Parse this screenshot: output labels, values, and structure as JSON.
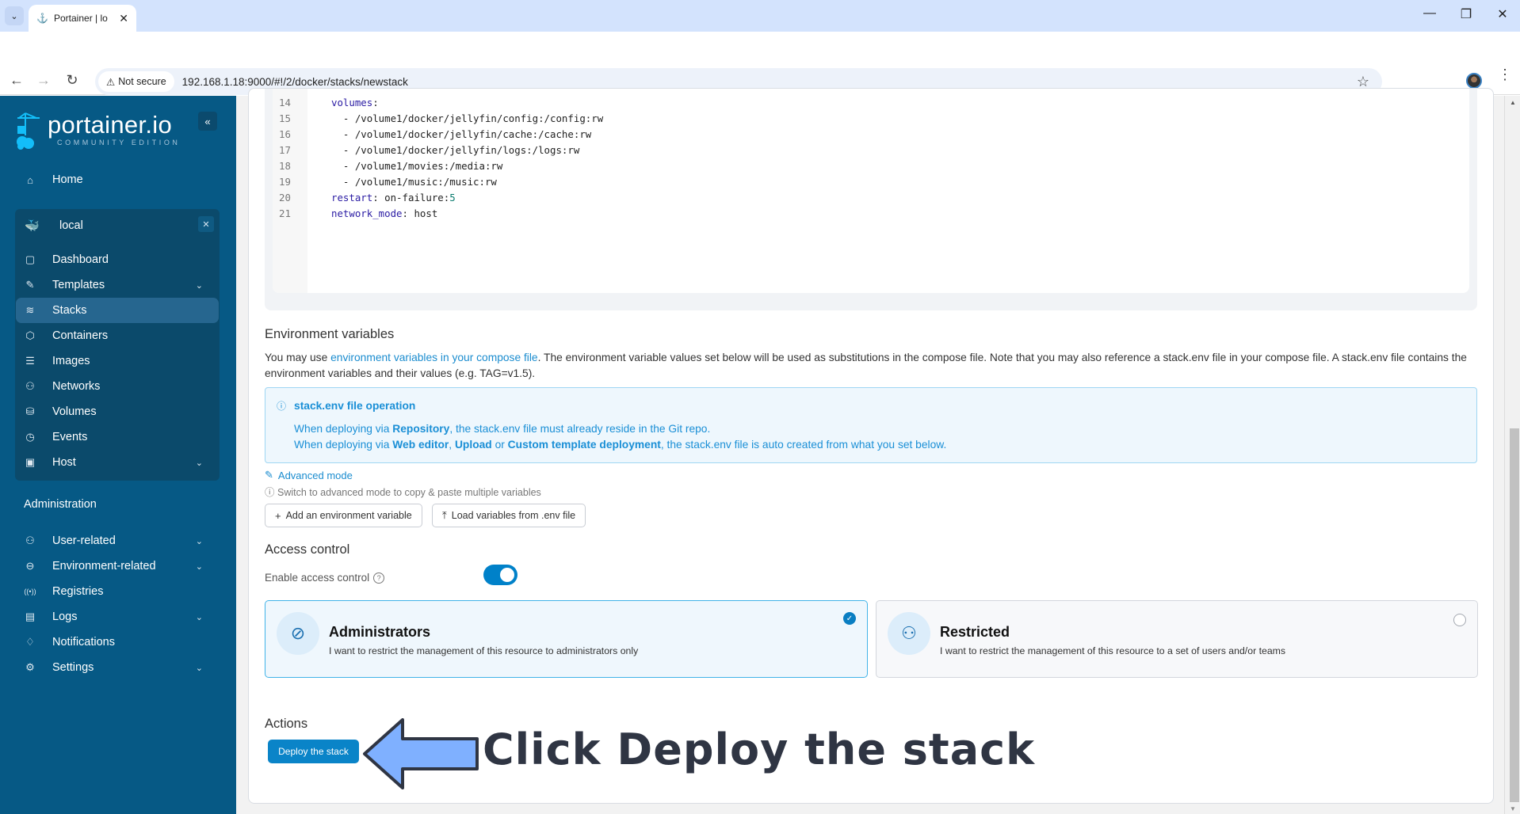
{
  "browser": {
    "tab_title": "Portainer | lo",
    "security_label": "Not secure",
    "url": "192.168.1.18:9000/#!/2/docker/stacks/newstack"
  },
  "sidebar": {
    "logo_name": "portainer.io",
    "logo_edition": "COMMUNITY EDITION",
    "home": "Home",
    "environment": {
      "name": "local",
      "items": [
        {
          "label": "Dashboard",
          "icon": "dashboard-icon",
          "glyph": "▢",
          "expandable": false
        },
        {
          "label": "Templates",
          "icon": "edit-icon",
          "glyph": "✎",
          "expandable": true
        },
        {
          "label": "Stacks",
          "icon": "layers-icon",
          "glyph": "≋",
          "expandable": false,
          "active": true
        },
        {
          "label": "Containers",
          "icon": "box-icon",
          "glyph": "⬡",
          "expandable": false
        },
        {
          "label": "Images",
          "icon": "list-icon",
          "glyph": "☰",
          "expandable": false
        },
        {
          "label": "Networks",
          "icon": "network-icon",
          "glyph": "⚇",
          "expandable": false
        },
        {
          "label": "Volumes",
          "icon": "database-icon",
          "glyph": "⛁",
          "expandable": false
        },
        {
          "label": "Events",
          "icon": "clock-icon",
          "glyph": "◷",
          "expandable": false
        },
        {
          "label": "Host",
          "icon": "host-icon",
          "glyph": "▣",
          "expandable": true
        }
      ]
    },
    "admin_heading": "Administration",
    "admin_items": [
      {
        "label": "User-related",
        "icon": "users-icon",
        "glyph": "⚇",
        "expandable": true
      },
      {
        "label": "Environment-related",
        "icon": "drive-icon",
        "glyph": "⊖",
        "expandable": true
      },
      {
        "label": "Registries",
        "icon": "radio-icon",
        "glyph": "((•))",
        "expandable": false
      },
      {
        "label": "Logs",
        "icon": "file-icon",
        "glyph": "▤",
        "expandable": true
      },
      {
        "label": "Notifications",
        "icon": "bell-icon",
        "glyph": "♢",
        "expandable": false
      },
      {
        "label": "Settings",
        "icon": "gear-icon",
        "glyph": "⚙",
        "expandable": true
      }
    ]
  },
  "editor": {
    "lines": [
      {
        "n": "14",
        "indent": "",
        "key": "volumes",
        "sep": ":",
        "val": ""
      },
      {
        "n": "15",
        "indent": "  ",
        "key": "",
        "sep": "",
        "val": "- /volume1/docker/jellyfin/config:/config:rw"
      },
      {
        "n": "16",
        "indent": "  ",
        "key": "",
        "sep": "",
        "val": "- /volume1/docker/jellyfin/cache:/cache:rw"
      },
      {
        "n": "17",
        "indent": "  ",
        "key": "",
        "sep": "",
        "val": "- /volume1/docker/jellyfin/logs:/logs:rw"
      },
      {
        "n": "18",
        "indent": "  ",
        "key": "",
        "sep": "",
        "val": "- /volume1/movies:/media:rw"
      },
      {
        "n": "19",
        "indent": "  ",
        "key": "",
        "sep": "",
        "val": "- /volume1/music:/music:rw"
      },
      {
        "n": "20",
        "indent": "",
        "key": "restart",
        "sep": ": ",
        "val": "on-failure:",
        "num": "5"
      },
      {
        "n": "21",
        "indent": "",
        "key": "network_mode",
        "sep": ": ",
        "val": "host"
      }
    ]
  },
  "env_vars": {
    "title": "Environment variables",
    "desc_prefix": "You may use ",
    "desc_link": "environment variables in your compose file",
    "desc_suffix": ". The environment variable values set below will be used as substitutions in the compose file. Note that you may also reference a stack.env file in your compose file. A stack.env file contains the environment variables and their values (e.g. TAG=v1.5).",
    "info_title": "stack.env file operation",
    "info_l1_a": "When deploying via ",
    "info_l1_b": "Repository",
    "info_l1_c": ", the stack.env file must already reside in the Git repo.",
    "info_l2_a": "When deploying via ",
    "info_l2_b": "Web editor",
    "info_l2_c": ", ",
    "info_l2_d": "Upload",
    "info_l2_e": " or ",
    "info_l2_f": "Custom template deployment",
    "info_l2_g": ", the stack.env file is auto created from what you set below.",
    "advanced_mode": "Advanced mode",
    "advanced_hint": "Switch to advanced mode to copy & paste multiple variables",
    "add_button": "Add an environment variable",
    "load_button": "Load variables from .env file"
  },
  "access_control": {
    "title": "Access control",
    "enable_label": "Enable access control",
    "enabled": true,
    "options": [
      {
        "title": "Administrators",
        "desc": "I want to restrict the management of this resource to administrators only",
        "selected": true
      },
      {
        "title": "Restricted",
        "desc": "I want to restrict the management of this resource to a set of users and/or teams",
        "selected": false
      }
    ]
  },
  "actions": {
    "title": "Actions",
    "deploy_button": "Deploy the stack"
  },
  "annotation": {
    "text": "Click Deploy the stack",
    "arrow_color": "#7fb0ff"
  }
}
